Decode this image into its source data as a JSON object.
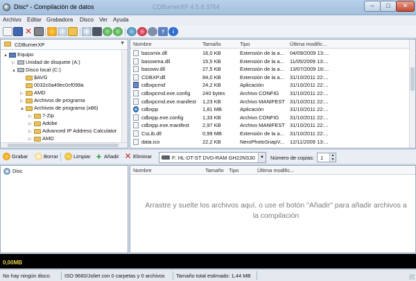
{
  "window": {
    "title": "Disc* - Compilación de datos",
    "ghost_title": "CDBurnerXP 4.5.8.3764"
  },
  "menu": [
    "Archivo",
    "Editar",
    "Grabadora",
    "Disco",
    "Ver",
    "Ayuda"
  ],
  "toolbar_icons": [
    "new-icon",
    "save-icon",
    "delete-icon",
    "print-icon",
    "burn-icon",
    "erase-icon",
    "properties-icon",
    "refresh-icon",
    "eject-icon",
    "back-icon",
    "forward-icon",
    "globe-icon",
    "settings-icon",
    "help-icon",
    "info-icon"
  ],
  "tree": {
    "location": "CDBurnerXP",
    "items": [
      {
        "label": "Equipo",
        "level": 0,
        "exp": "▲",
        "icon": "pc"
      },
      {
        "label": "Unidad de disquete (A:)",
        "level": 1,
        "exp": "▷",
        "icon": "drive"
      },
      {
        "label": "Disco local (C:)",
        "level": 1,
        "exp": "▲",
        "icon": "drive"
      },
      {
        "label": "$AVG",
        "level": 2,
        "exp": "",
        "icon": "folder"
      },
      {
        "label": "0032c0a49ec0cf099a",
        "level": 2,
        "exp": "",
        "icon": "folder"
      },
      {
        "label": "AMD",
        "level": 2,
        "exp": "▷",
        "icon": "folder"
      },
      {
        "label": "Archivos de programa",
        "level": 2,
        "exp": "▷",
        "icon": "folder"
      },
      {
        "label": "Archivos de programa (x86)",
        "level": 2,
        "exp": "▲",
        "icon": "folder"
      },
      {
        "label": "7-Zip",
        "level": 3,
        "exp": "▷",
        "icon": "folder"
      },
      {
        "label": "Adobe",
        "level": 3,
        "exp": "▷",
        "icon": "folder"
      },
      {
        "label": "Advanced IP Address Calculator",
        "level": 3,
        "exp": "▷",
        "icon": "folder"
      },
      {
        "label": "AMD",
        "level": 3,
        "exp": "▷",
        "icon": "folder"
      }
    ]
  },
  "files": {
    "columns": [
      "Nombre",
      "Tamaño",
      "Tipo",
      "Última modific..."
    ],
    "rows": [
      {
        "name": "bassmix.dll",
        "size": "16,0 KB",
        "type": "Extensión de la a...",
        "date": "04/09/2009 13:...",
        "icon": "file"
      },
      {
        "name": "basswma.dll",
        "size": "15,5 KB",
        "type": "Extensión de la a...",
        "date": "11/05/2009 13:...",
        "icon": "file"
      },
      {
        "name": "basswv.dll",
        "size": "27,5 KB",
        "type": "Extensión de la a...",
        "date": "13/07/2009 16:...",
        "icon": "file"
      },
      {
        "name": "CDBXP.dll",
        "size": "84,0 KB",
        "type": "Extensión de la a...",
        "date": "31/10/2011 22:...",
        "icon": "file"
      },
      {
        "name": "cdbxpcmd",
        "size": "24,2 KB",
        "type": "Aplicación",
        "date": "31/10/2011 22:...",
        "icon": "app"
      },
      {
        "name": "cdbxpcmd.exe.config",
        "size": "240 bytes",
        "type": "Archivo CONFIG",
        "date": "31/10/2011 22:...",
        "icon": "file"
      },
      {
        "name": "cdbxpcmd.exe.manifest",
        "size": "1,23 KB",
        "type": "Archivo MANIFEST",
        "date": "31/10/2011 22:...",
        "icon": "file"
      },
      {
        "name": "cdbxpp",
        "size": "1,81 MB",
        "type": "Aplicación",
        "date": "31/10/2011 22:...",
        "icon": "disc"
      },
      {
        "name": "cdbxpp.exe.config",
        "size": "1,33 KB",
        "type": "Archivo CONFIG",
        "date": "31/10/2011 22:...",
        "icon": "file"
      },
      {
        "name": "cdbxpp.exe.manifest",
        "size": "2,97 KB",
        "type": "Archivo MANIFEST",
        "date": "31/10/2011 22:...",
        "icon": "file"
      },
      {
        "name": "CsLib.dll",
        "size": "0,99 MB",
        "type": "Extensión de la a...",
        "date": "31/10/2011 22:...",
        "icon": "file"
      },
      {
        "name": "data.ico",
        "size": "22,2 KB",
        "type": "NeroPhotoSnapV...",
        "date": "12/11/2009 13:...",
        "icon": "file"
      }
    ]
  },
  "actions": {
    "burn": "Grabar",
    "erase": "Borrar",
    "clean": "Limpiar",
    "add": "Añadir",
    "remove": "Eliminar",
    "drive": "F: HL-DT-ST DVD-RAM GH22NS30",
    "copies_label": "Número de copias:",
    "copies": "1"
  },
  "disc_tree": {
    "root": "Disc"
  },
  "compilation": {
    "columns": [
      "Nombre",
      "Tamaño",
      "Tipo",
      "Última modific..."
    ],
    "hint": "Arrastre y suelte los archivos aquí, o use el botón \"Añadir\" para añadir archivos a la compilación"
  },
  "capacity": {
    "label": "0,00MB"
  },
  "status": {
    "disc": "No hay ningún disco",
    "format": "ISO 9660/Joliet con 0 carpetas y 0 archivos",
    "estimated": "Tamaño total estimado: 1,44 MB"
  },
  "colors": {
    "accent": "#3a78c4",
    "capacity_bg": "#000000",
    "capacity_text": "#e8d24a"
  }
}
